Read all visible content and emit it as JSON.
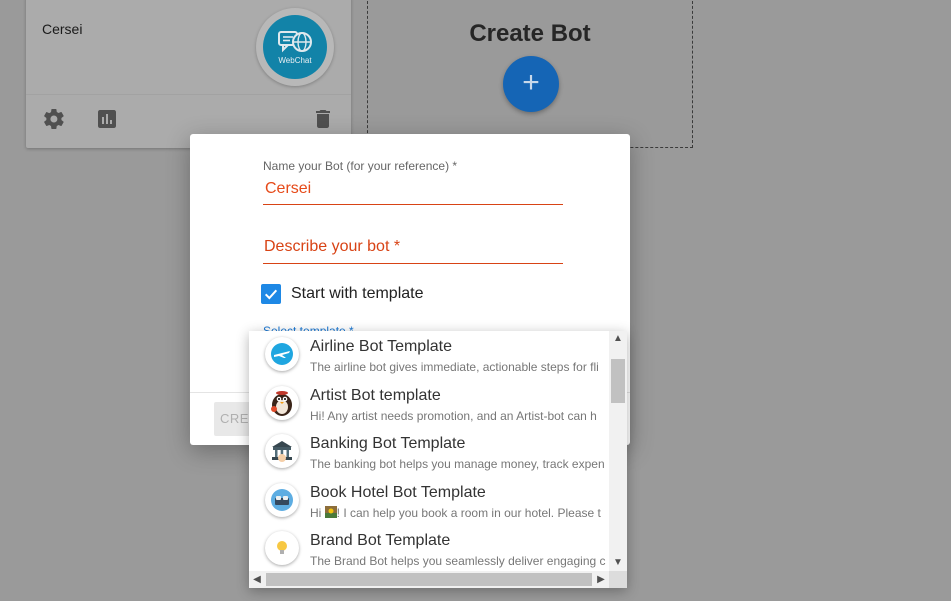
{
  "bot_card": {
    "name": "Cersei",
    "channel_badge": "WebChat",
    "actions": [
      {
        "icon": "gear-icon"
      },
      {
        "icon": "bar-chart-icon"
      },
      {
        "icon": "trash-icon"
      }
    ]
  },
  "create_card": {
    "title": "Create Bot",
    "button_symbol": "+"
  },
  "dialog": {
    "name_field": {
      "label": "Name your Bot (for your reference) *",
      "value": "Cersei"
    },
    "describe_field": {
      "placeholder": "Describe your bot *"
    },
    "template_checkbox": {
      "label": "Start with template",
      "checked": true
    },
    "select_template_label": "Select template *",
    "create_button": "CREATE"
  },
  "templates": [
    {
      "title": "Airline Bot Template",
      "desc": "The airline bot gives immediate, actionable steps for fli",
      "icon": "airplane-icon"
    },
    {
      "title": "Artist Bot template",
      "desc": "Hi! Any artist needs promotion, and an Artist-bot can h",
      "icon": "artist-penguin-icon"
    },
    {
      "title": "Banking Bot Template",
      "desc": "The banking bot helps you manage money, track expen",
      "icon": "bank-icon"
    },
    {
      "title": "Book Hotel Bot Template",
      "desc_prefix": "Hi ",
      "desc_suffix": "! I can help you book a room in our hotel. Please t",
      "icon": "hotel-icon"
    },
    {
      "title": "Brand Bot Template",
      "desc": "The Brand Bot helps you seamlessly deliver engaging c",
      "icon": "lightbulb-icon"
    }
  ],
  "colors": {
    "accent": "#1e88e5",
    "error": "#d84315",
    "fab": "#1565b5",
    "overlay": "#9a9a9a"
  }
}
